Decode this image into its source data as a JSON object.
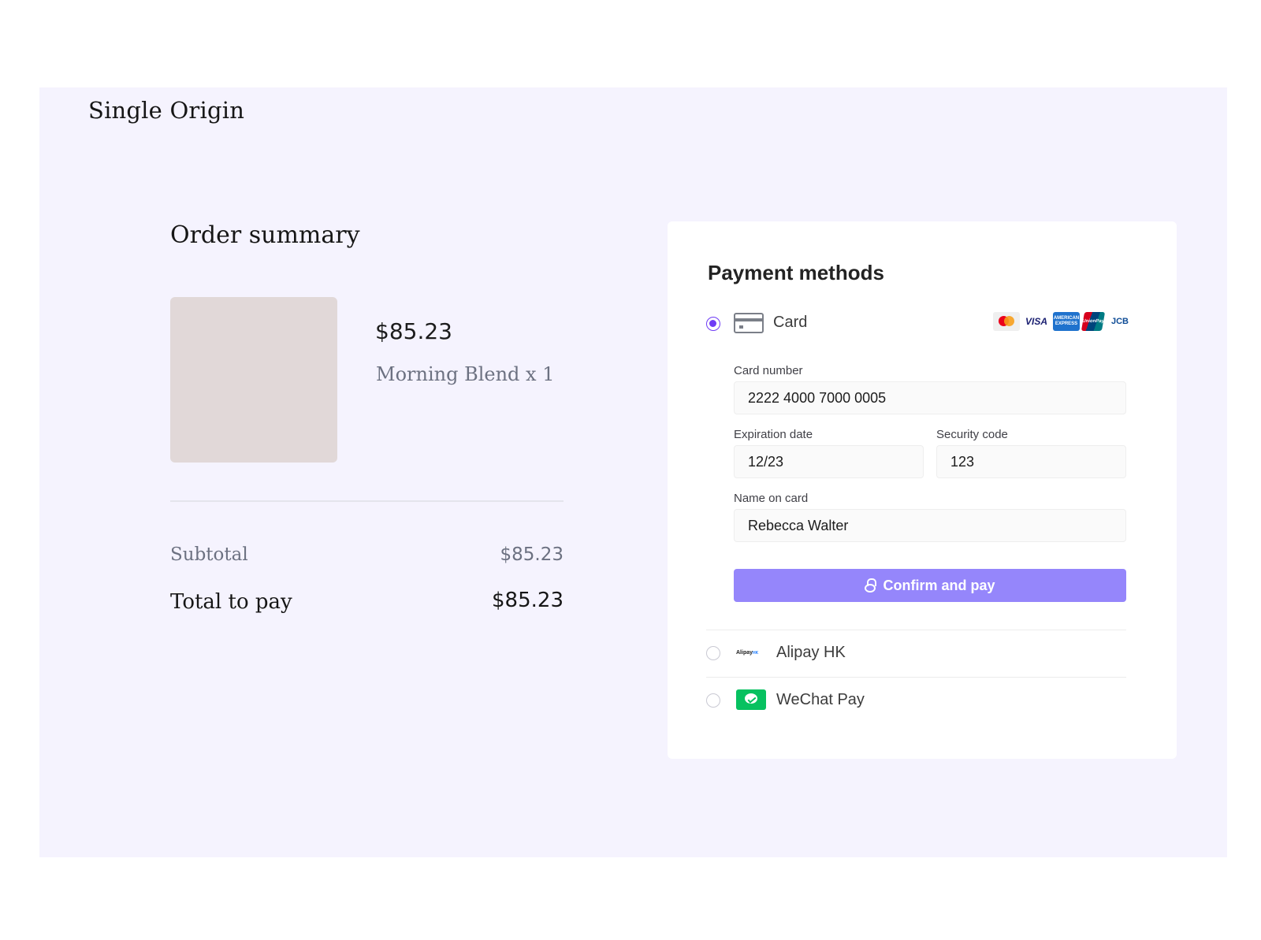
{
  "header": {
    "brand": "Single Origin"
  },
  "order_summary": {
    "title": "Order summary",
    "item": {
      "price": "$85.23",
      "name": "Morning Blend x 1"
    },
    "subtotal_label": "Subtotal",
    "subtotal_value": "$85.23",
    "total_label": "Total to pay",
    "total_value": "$85.23"
  },
  "payment": {
    "title": "Payment methods",
    "card": {
      "label": "Card",
      "selected": true,
      "brands": [
        "Mastercard",
        "VISA",
        "AMERICAN EXPRESS",
        "UnionPay",
        "JCB"
      ],
      "brand_text": {
        "visa": "VISA",
        "amex": "AMERICAN EXPRESS",
        "unionpay": "UnionPay",
        "jcb": "JCB"
      },
      "card_number_label": "Card number",
      "card_number_value": "2222 4000 7000 0005",
      "expiration_label": "Expiration date",
      "expiration_value": "12/23",
      "security_label": "Security code",
      "security_value": "123",
      "name_label": "Name on card",
      "name_value": "Rebecca Walter",
      "confirm_label": "Confirm and pay"
    },
    "alipay": {
      "label": "Alipay HK",
      "logo_text": "Alipay",
      "logo_suffix": "HK"
    },
    "wechat": {
      "label": "WeChat Pay"
    }
  },
  "colors": {
    "page_background": "#f5f3fe",
    "accent": "#6f3cf5",
    "button": "#9586fb",
    "wechat_green": "#07c160",
    "product_placeholder": "#e1d8d8"
  }
}
